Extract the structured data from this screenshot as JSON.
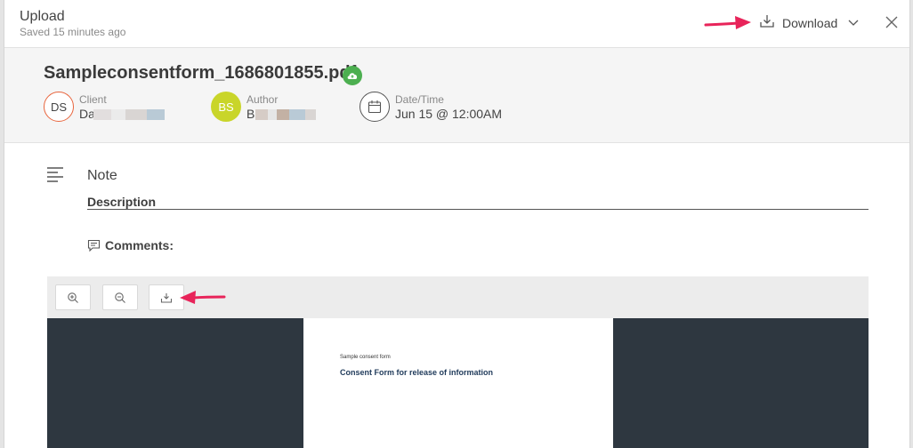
{
  "topbar": {
    "title": "Upload",
    "saved": "Saved 15 minutes ago",
    "download_label": "Download",
    "icons": {
      "download": "download-tray-icon",
      "dropdown": "chevron-down-icon",
      "close": "close-icon"
    }
  },
  "header": {
    "filename": "Sampleconsentform_1686801855.pdf",
    "cloud_icon": "cloud-upload-icon",
    "client": {
      "label": "Client",
      "initials": "DS",
      "value": "Da",
      "ring_color": "#e8643c"
    },
    "author": {
      "label": "Author",
      "initials": "BS",
      "value": "B",
      "bg_color": "#c9d52a"
    },
    "datetime": {
      "label": "Date/Time",
      "value": "Jun 15 @ 12:00AM",
      "icon": "calendar-icon"
    }
  },
  "note": {
    "label": "Note",
    "icon": "text-align-left-icon"
  },
  "description": {
    "label": "Description"
  },
  "comments": {
    "label": "Comments:",
    "icon": "comment-icon"
  },
  "viewer": {
    "toolbar": [
      "zoom-in-icon",
      "zoom-out-icon",
      "download-tray-icon"
    ],
    "page": {
      "small_text": "Sample consent form",
      "heading": "Consent Form for release of information"
    }
  },
  "colors": {
    "accent_arrow": "#e8245a",
    "cloud_green": "#4caf50",
    "viewer_bg": "#2e3740",
    "doc_heading": "#1f3a5a"
  }
}
